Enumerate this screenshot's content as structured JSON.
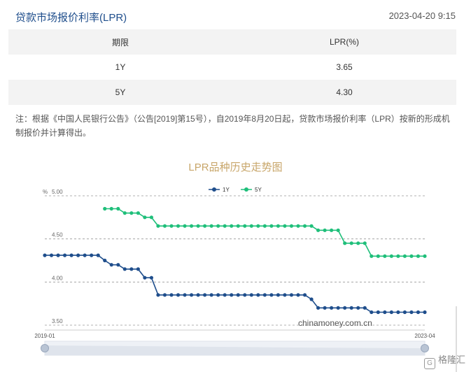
{
  "header": {
    "title": "贷款市场报价利率(LPR)",
    "timestamp": "2023-04-20 9:15"
  },
  "table": {
    "headers": [
      "期限",
      "LPR(%)"
    ],
    "rows": [
      [
        "1Y",
        "3.65"
      ],
      [
        "5Y",
        "4.30"
      ]
    ]
  },
  "note": "注：根据《中国人民银行公告》（公告[2019]第15号），自2019年8月20日起，贷款市场报价利率（LPR）按新的形成机制报价并计算得出。",
  "watermark": "格隆汇",
  "chart_data": {
    "type": "line",
    "title": "LPR品种历史走势图",
    "ylabel": "%",
    "source": "chinamoney.com.cn",
    "ylim": [
      3.5,
      5.0
    ],
    "yticks": [
      "5.00",
      "4.50",
      "4.00",
      "3.50"
    ],
    "x_start_label": "2019-01",
    "x_end_label": "2023-04",
    "legend_position": "top-center",
    "grid": true,
    "colors": {
      "1Y": "#1f4e8c",
      "5Y": "#1fbf7a"
    },
    "series": [
      {
        "name": "1Y",
        "values": [
          4.31,
          4.31,
          4.31,
          4.31,
          4.31,
          4.31,
          4.31,
          4.31,
          4.31,
          4.25,
          4.2,
          4.2,
          4.15,
          4.15,
          4.15,
          4.05,
          4.05,
          3.85,
          3.85,
          3.85,
          3.85,
          3.85,
          3.85,
          3.85,
          3.85,
          3.85,
          3.85,
          3.85,
          3.85,
          3.85,
          3.85,
          3.85,
          3.85,
          3.85,
          3.85,
          3.85,
          3.85,
          3.85,
          3.85,
          3.85,
          3.8,
          3.7,
          3.7,
          3.7,
          3.7,
          3.7,
          3.7,
          3.7,
          3.7,
          3.65,
          3.65,
          3.65,
          3.65,
          3.65,
          3.65,
          3.65,
          3.65,
          3.65
        ]
      },
      {
        "name": "5Y",
        "values": [
          null,
          null,
          null,
          null,
          null,
          null,
          null,
          null,
          null,
          4.85,
          4.85,
          4.85,
          4.8,
          4.8,
          4.8,
          4.75,
          4.75,
          4.65,
          4.65,
          4.65,
          4.65,
          4.65,
          4.65,
          4.65,
          4.65,
          4.65,
          4.65,
          4.65,
          4.65,
          4.65,
          4.65,
          4.65,
          4.65,
          4.65,
          4.65,
          4.65,
          4.65,
          4.65,
          4.65,
          4.65,
          4.65,
          4.6,
          4.6,
          4.6,
          4.6,
          4.45,
          4.45,
          4.45,
          4.45,
          4.3,
          4.3,
          4.3,
          4.3,
          4.3,
          4.3,
          4.3,
          4.3,
          4.3
        ]
      }
    ]
  }
}
